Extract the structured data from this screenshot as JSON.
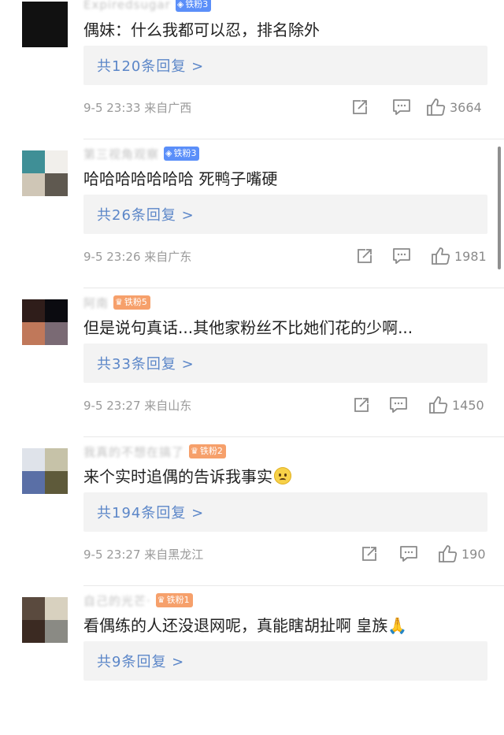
{
  "comments": [
    {
      "username": "Expiredsugar",
      "badge": {
        "label": "铁粉3",
        "style": "blue"
      },
      "text": "偶妹：什么我都可以忍，排名除外",
      "emoji": "",
      "reply_label": "共120条回复 >",
      "timestamp": "9-5 23:33 来自广西",
      "likes": "3664",
      "avatar_colors": [
        "#111111",
        "#111111",
        "#111111",
        "#111111"
      ]
    },
    {
      "username": "第三视角观察",
      "badge": {
        "label": "铁粉3",
        "style": "blue"
      },
      "text": "哈哈哈哈哈哈哈 死鸭子嘴硬",
      "emoji": "",
      "reply_label": "共26条回复 >",
      "timestamp": "9-5 23:26 来自广东",
      "likes": "1981",
      "avatar_colors": [
        "#3f8f96",
        "#f1efeb",
        "#cfc6b6",
        "#5f5950"
      ]
    },
    {
      "username": "阿南",
      "badge": {
        "label": "铁粉5",
        "style": "orange"
      },
      "text": "但是说句真话...其他家粉丝不比她们花的少啊...",
      "emoji": "",
      "reply_label": "共33条回复 >",
      "timestamp": "9-5 23:27 来自山东",
      "likes": "1450",
      "avatar_colors": [
        "#2f1d1a",
        "#0b0b10",
        "#c0785a",
        "#7a6a74"
      ]
    },
    {
      "username": "我真的不想在搞了",
      "badge": {
        "label": "铁粉2",
        "style": "orange"
      },
      "text": "来个实时追偶的告诉我事实",
      "emoji": "pleading-face",
      "reply_label": "共194条回复 >",
      "timestamp": "9-5 23:27 来自黑龙江",
      "likes": "190",
      "avatar_colors": [
        "#dfe3ea",
        "#c6c2a8",
        "#5a6fa6",
        "#5e5a3a"
      ]
    },
    {
      "username": "自己的光芒·",
      "badge": {
        "label": "铁粉1",
        "style": "orange"
      },
      "text": "看偶练的人还没退网呢，真能瞎胡扯啊 皇族",
      "emoji": "folded-hands",
      "reply_label": "共9条回复 >",
      "timestamp": "",
      "likes": "",
      "avatar_colors": [
        "#5a4a3e",
        "#d8d1bf",
        "#3b2a22",
        "#8a8a84"
      ]
    }
  ],
  "icons": {
    "share": "share-icon",
    "comment": "comment-icon",
    "like": "thumbs-up-icon",
    "badge": "diamond-icon"
  },
  "colors": {
    "reply_link": "#5b86c8",
    "badge_blue": "#5b8ff9",
    "badge_orange": "#f6a06b"
  }
}
